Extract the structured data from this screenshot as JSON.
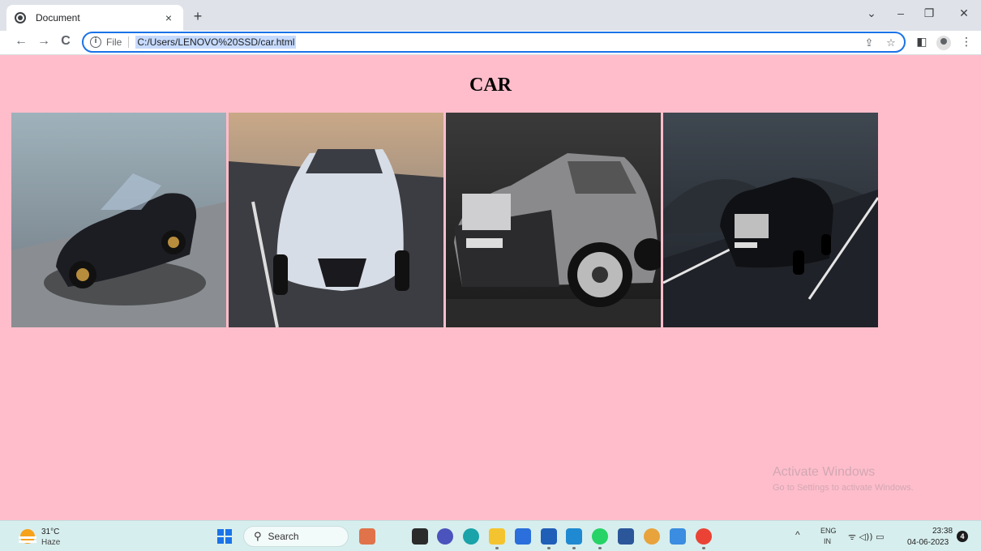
{
  "tab": {
    "title": "Document",
    "close": "×",
    "new": "+"
  },
  "window": {
    "collapse": "⌄",
    "minimize": "–",
    "restore": "❐",
    "close": "✕"
  },
  "toolbar": {
    "back": "←",
    "forward": "→",
    "reload": "C",
    "scheme": "File",
    "url": "C:/Users/LENOVO%20SSD/car.html",
    "share": "⇪",
    "bookmark": "☆",
    "sidepanel": "◧",
    "menu": "⋮"
  },
  "page": {
    "title": "CAR"
  },
  "cars": [
    {
      "icon": "sports-car-image",
      "body": "#1c1d22",
      "bg1": "#9fb2bb",
      "bg2": "#6e7780",
      "road": "#8a8e92"
    },
    {
      "icon": "hypercar-image",
      "body": "#d7dde6",
      "bg1": "#c9a887",
      "bg2": "#6a6f78",
      "road": "#3c3d42"
    },
    {
      "icon": "luxury-coupe-image",
      "body": "#2b2b2d",
      "bg1": "#3a3a3a",
      "bg2": "#1a1a1a",
      "road": "#2a2a2a"
    },
    {
      "icon": "convertible-image",
      "body": "#101114",
      "bg1": "#3f4750",
      "bg2": "#1c2026",
      "road": "#1f2228"
    }
  ],
  "watermark": {
    "line1": "Activate Windows",
    "line2": "Go to Settings to activate Windows."
  },
  "taskbar": {
    "temp": "31°C",
    "condition": "Haze",
    "search": "Search",
    "apps": [
      {
        "name": "paint-app-icon",
        "color": "#e0734a"
      },
      {
        "name": "task-view-icon",
        "color": "#2b2b2b"
      },
      {
        "name": "chat-icon",
        "color": "#4b53bc"
      },
      {
        "name": "edge-icon",
        "color": "#1aa3a9"
      },
      {
        "name": "file-explorer-icon",
        "color": "#f4c430"
      },
      {
        "name": "store-icon",
        "color": "#2a6fdb"
      },
      {
        "name": "mail-icon",
        "color": "#1f5fb8"
      },
      {
        "name": "vscode-icon",
        "color": "#1f8ad2"
      },
      {
        "name": "whatsapp-icon",
        "color": "#25d366"
      },
      {
        "name": "word-icon",
        "color": "#2b579a"
      },
      {
        "name": "chrome-canary-icon",
        "color": "#e8a33c"
      },
      {
        "name": "photos-icon",
        "color": "#3a8de0"
      },
      {
        "name": "chrome-icon",
        "color": "#ea4335"
      }
    ],
    "tray_up": "^",
    "lang": "ENG",
    "region": "IN",
    "tray": "ᯤ ◁)) ▭",
    "time": "23:38",
    "date": "04-06-2023",
    "notifications": "4"
  }
}
